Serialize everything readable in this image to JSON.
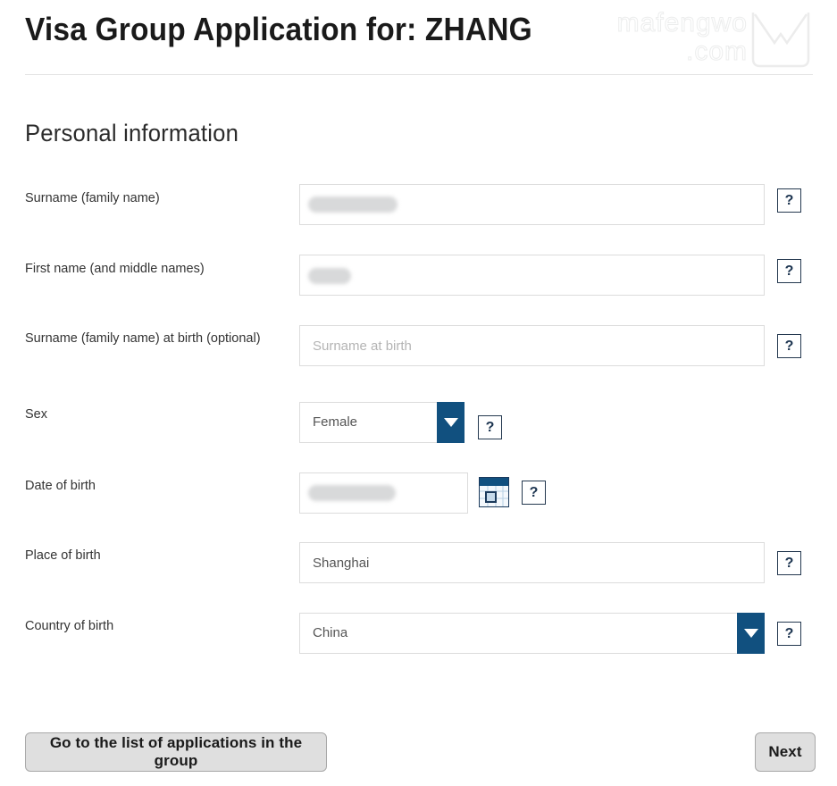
{
  "header": {
    "title": "Visa Group Application for: ZHANG",
    "watermark_line1": "mafengwo",
    "watermark_line2": ".com",
    "watermark_logo_icon": "mafengwo-m-logo-icon"
  },
  "section": {
    "title": "Personal information"
  },
  "help_label": "?",
  "fields": [
    {
      "label": "Surname (family name)",
      "type": "text",
      "value": "",
      "placeholder": "",
      "redacted": true,
      "help": "?"
    },
    {
      "label": "First name (and middle names)",
      "type": "text",
      "value": "",
      "placeholder": "",
      "redacted": true,
      "help": "?"
    },
    {
      "label": "Surname (family name) at birth (optional)",
      "type": "text",
      "value": "",
      "placeholder": "Surname at birth",
      "redacted": false,
      "help": "?"
    },
    {
      "label": "Sex",
      "type": "select",
      "value": "Female",
      "help": "?"
    },
    {
      "label": "Date of birth",
      "type": "date",
      "value": "",
      "redacted": true,
      "calendar_icon": "calendar-icon",
      "help": "?"
    },
    {
      "label": "Place of birth",
      "type": "text",
      "value": "Shanghai",
      "placeholder": "",
      "redacted": false,
      "help": "?"
    },
    {
      "label": "Country of birth",
      "type": "select",
      "value": "China",
      "help": "?"
    }
  ],
  "footer": {
    "back_label": "Go to the list of applications in the group",
    "next_label": "Next"
  },
  "colors": {
    "accent_blue": "#11507f",
    "help_border": "#24384f",
    "button_face": "#dfdfdf",
    "rule": "#e4e4e4"
  }
}
